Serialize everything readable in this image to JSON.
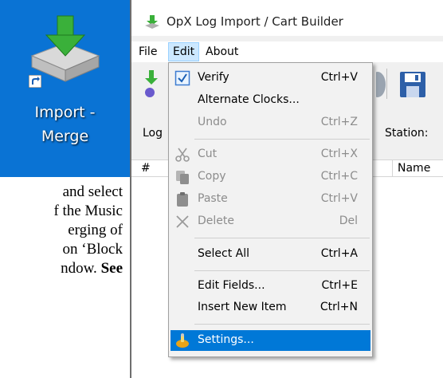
{
  "desktop_icon": {
    "label_line1": "Import -",
    "label_line2": "Merge",
    "icon": "import-merge-icon"
  },
  "document": {
    "lines": [
      "and select",
      "f the Music",
      "erging of",
      "on ‘Block",
      "ndow. "
    ],
    "bold_tail": "See"
  },
  "window": {
    "title": "OpX Log Import / Cart Builder",
    "title_icon": "opx-app-icon",
    "menu": {
      "file": "File",
      "edit": "Edit",
      "about": "About"
    },
    "filter": {
      "log_label": "Log",
      "station_label": "Station:"
    },
    "columns": {
      "number": "#",
      "name": "Name"
    }
  },
  "edit_menu": {
    "items": [
      {
        "label": "Verify",
        "shortcut": "Ctrl+V",
        "icon": "verify-checkbox-icon",
        "enabled": true
      },
      {
        "label": "Alternate Clocks...",
        "shortcut": "",
        "icon": "",
        "enabled": true
      },
      {
        "label": "Undo",
        "shortcut": "Ctrl+Z",
        "icon": "",
        "enabled": false
      },
      {
        "label": "Cut",
        "shortcut": "Ctrl+X",
        "icon": "scissors-icon",
        "enabled": false
      },
      {
        "label": "Copy",
        "shortcut": "Ctrl+C",
        "icon": "copy-icon",
        "enabled": false
      },
      {
        "label": "Paste",
        "shortcut": "Ctrl+V",
        "icon": "paste-icon",
        "enabled": false
      },
      {
        "label": "Delete",
        "shortcut": "Del",
        "icon": "delete-x-icon",
        "enabled": false
      },
      {
        "label": "Select All",
        "shortcut": "Ctrl+A",
        "icon": "",
        "enabled": true
      },
      {
        "label": "Edit Fields...",
        "shortcut": "Ctrl+E",
        "icon": "",
        "enabled": true
      },
      {
        "label": "Insert New Item",
        "shortcut": "Ctrl+N",
        "icon": "",
        "enabled": true
      },
      {
        "label": "Settings...",
        "shortcut": "",
        "icon": "settings-icon",
        "enabled": true
      }
    ]
  },
  "colors": {
    "desktop_blue": "#0a73d4",
    "highlight_blue": "#0078d7",
    "active_menu_bg": "#cce8ff"
  }
}
